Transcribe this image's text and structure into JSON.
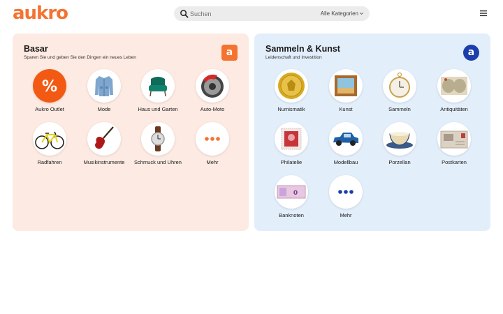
{
  "header": {
    "logo": "aukro",
    "search_placeholder": "Suchen",
    "category_select": "Alle Kategorien"
  },
  "basar": {
    "title": "Basar",
    "subtitle": "Sparen Sie und geben Sie den Dingen ein neues Leben",
    "badge": "a",
    "items": [
      {
        "label": "Aukro Outlet",
        "icon": "percent-icon"
      },
      {
        "label": "Mode",
        "icon": "jacket-icon"
      },
      {
        "label": "Haus und Garten",
        "icon": "armchair-icon"
      },
      {
        "label": "Auto-Moto",
        "icon": "brake-disc-icon"
      },
      {
        "label": "Radfahren",
        "icon": "bicycle-icon"
      },
      {
        "label": "Musikinstrumente",
        "icon": "guitar-icon"
      },
      {
        "label": "Schmuck und Uhren",
        "icon": "watch-icon"
      },
      {
        "label": "Mehr",
        "icon": "more-dots-icon"
      }
    ]
  },
  "kunst": {
    "title": "Sammeln & Kunst",
    "subtitle": "Leidenschaft und Investition",
    "badge": "a",
    "items": [
      {
        "label": "Numismatik",
        "icon": "gold-coin-icon"
      },
      {
        "label": "Kunst",
        "icon": "painting-icon"
      },
      {
        "label": "Sammeln",
        "icon": "pocket-watch-icon"
      },
      {
        "label": "Antiquitäten",
        "icon": "old-map-icon"
      },
      {
        "label": "Philatelie",
        "icon": "stamp-icon"
      },
      {
        "label": "Modellbau",
        "icon": "model-car-icon"
      },
      {
        "label": "Porzellan",
        "icon": "porcelain-cup-icon"
      },
      {
        "label": "Postkarten",
        "icon": "postcard-icon"
      },
      {
        "label": "Banknoten",
        "icon": "banknote-icon"
      },
      {
        "label": "Mehr",
        "icon": "more-dots-icon"
      }
    ]
  },
  "colors": {
    "brand_orange": "#f47330",
    "brand_blue": "#1b3faa",
    "basar_bg": "#fdeae2",
    "kunst_bg": "#e3eefb"
  }
}
